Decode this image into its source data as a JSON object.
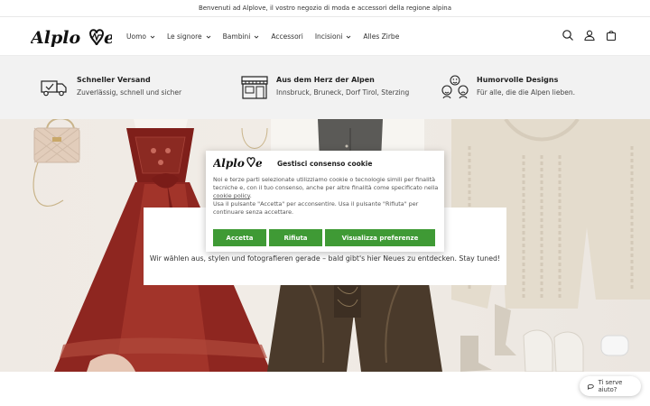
{
  "announcement": "Benvenuti ad Alplove, il vostro negozio di moda e accessori della regione alpina",
  "logo": {
    "text": "Alplove"
  },
  "nav": [
    {
      "label": "Uomo",
      "dropdown": true
    },
    {
      "label": "Le signore",
      "dropdown": true
    },
    {
      "label": "Bambini",
      "dropdown": true
    },
    {
      "label": "Accessori",
      "dropdown": false
    },
    {
      "label": "Incisioni",
      "dropdown": true
    },
    {
      "label": "Alles Zirbe",
      "dropdown": false
    }
  ],
  "header_icons": [
    "search-icon",
    "account-icon",
    "cart-icon"
  ],
  "features": [
    {
      "title": "Schneller Versand",
      "subtitle": "Zuverlässig, schnell und sicher",
      "icon": "delivery-truck-icon"
    },
    {
      "title": "Aus dem Herz der Alpen",
      "subtitle": "Innsbruck, Bruneck, Dorf Tirol, Sterzing",
      "icon": "storefront-icon"
    },
    {
      "title": "Humorvolle Designs",
      "subtitle": "Für alle, die die Alpen lieben.",
      "icon": "faces-icon"
    }
  ],
  "hero": {
    "text": "Wir wählen aus, stylen und fotografieren gerade – bald gibt's hier Neues zu entdecken. Stay tuned!"
  },
  "cookie_modal": {
    "title": "Gestisci consenso cookie",
    "body_1": "Noi e terze parti selezionate utilizziamo cookie o tecnologie simili per finalità tecniche e, con il tuo consenso, anche per altre finalità come specificato nella ",
    "link": "cookie policy",
    "body_2": ".",
    "body_3": "Usa il pulsante \"Accetta\" per acconsentire. Usa il pulsante \"Rifiuta\" per continuare senza accettare.",
    "buttons": {
      "accept": "Accetta",
      "reject": "Rifiuta",
      "preferences": "Visualizza preferenze"
    }
  },
  "help_widget": {
    "label": "Ti serve aiuto?",
    "icon": "chat-bubble-icon"
  },
  "colors": {
    "accent_green": "#3f9a35",
    "dirndl_red": "#8b2a22",
    "feature_bg": "#f2f2f2"
  }
}
